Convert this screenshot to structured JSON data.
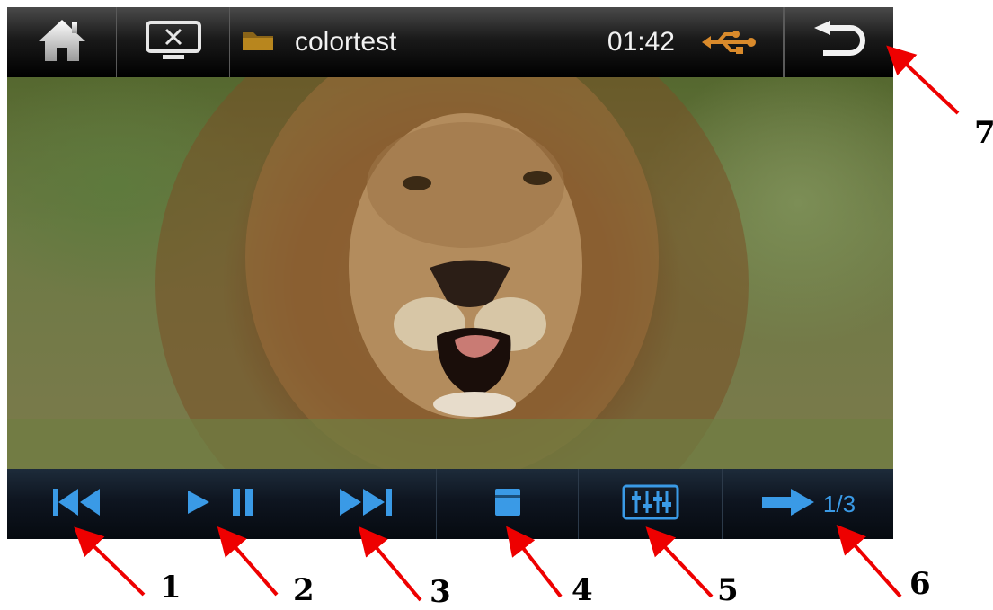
{
  "header": {
    "file_name": "colortest",
    "time": "01:42"
  },
  "footer": {
    "page_indicator": "1/3"
  },
  "callouts": [
    "1",
    "2",
    "3",
    "4",
    "5",
    "6",
    "7"
  ],
  "icons": {
    "home": "home-icon",
    "screen": "screen-off-icon",
    "folder": "folder-icon",
    "usb": "usb-icon",
    "back": "back-icon",
    "prev": "skip-previous-icon",
    "playpause": "play-pause-icon",
    "next": "skip-next-icon",
    "aspect": "aspect-ratio-icon",
    "eq": "equalizer-icon",
    "page": "next-page-arrow-icon"
  },
  "colors": {
    "control_accent": "#3a9ae6",
    "usb_accent": "#d98a2b",
    "annotation_arrow": "#ee0000"
  }
}
